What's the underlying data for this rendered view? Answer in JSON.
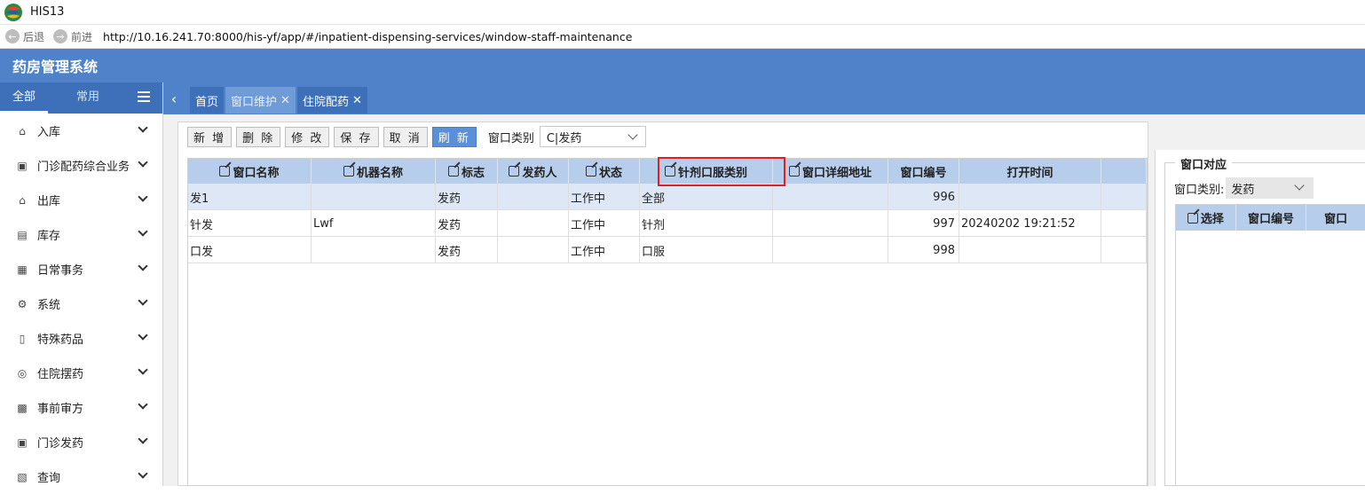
{
  "window": {
    "title": "HIS13"
  },
  "address_bar": {
    "back_label": "后退",
    "forward_label": "前进",
    "url": "http://10.16.241.70:8000/his-yf/app/#/inpatient-dispensing-services/window-staff-maintenance"
  },
  "app": {
    "title": "药房管理系统"
  },
  "sidebar": {
    "tabs": [
      "全部",
      "常用"
    ],
    "items": [
      {
        "label": "入库",
        "icon": "box-in-icon"
      },
      {
        "label": "门诊配药综合业务",
        "icon": "lock-icon"
      },
      {
        "label": "出库",
        "icon": "box-out-icon"
      },
      {
        "label": "库存",
        "icon": "inventory-icon"
      },
      {
        "label": "日常事务",
        "icon": "calendar-icon"
      },
      {
        "label": "系统",
        "icon": "gear-icon"
      },
      {
        "label": "特殊药品",
        "icon": "bottle-icon"
      },
      {
        "label": "住院摆药",
        "icon": "target-icon"
      },
      {
        "label": "事前审方",
        "icon": "briefcase-icon"
      },
      {
        "label": "门诊发药",
        "icon": "pill-icon"
      },
      {
        "label": "查询",
        "icon": "search-doc-icon"
      }
    ]
  },
  "tabs": [
    {
      "label": "首页",
      "closable": false,
      "active": false
    },
    {
      "label": "窗口维护",
      "closable": true,
      "active": true
    },
    {
      "label": "住院配药",
      "closable": true,
      "active": false
    }
  ],
  "toolbar": {
    "buttons": [
      "新 增",
      "删 除",
      "修 改",
      "保 存",
      "取 消",
      "刷 新"
    ],
    "window_type_label": "窗口类别",
    "window_type_value": "C|发药"
  },
  "grid": {
    "columns": [
      "窗口名称",
      "机器名称",
      "标志",
      "发药人",
      "状态",
      "针剂口服类别",
      "窗口详细地址",
      "窗口编号",
      "打开时间"
    ],
    "editable": [
      true,
      true,
      true,
      true,
      true,
      true,
      true,
      false,
      false
    ],
    "rows": [
      [
        "发1",
        "",
        "发药",
        "",
        "工作中",
        "全部",
        "",
        "996",
        ""
      ],
      [
        "针发",
        "Lwf",
        "发药",
        "",
        "工作中",
        "针剂",
        "",
        "997",
        "20240202 19:21:52"
      ],
      [
        "口发",
        "",
        "发药",
        "",
        "工作中",
        "口服",
        "",
        "998",
        ""
      ]
    ],
    "selected_row": 0,
    "highlighted_column": "针剂口服类别"
  },
  "right_panel": {
    "legend": "窗口对应",
    "filter_label": "窗口类别:",
    "filter_value": "发药",
    "columns": [
      "选择",
      "窗口编号",
      "窗口"
    ]
  },
  "colors": {
    "header_blue": "#4f82c8",
    "grid_header": "#b6cdeb",
    "highlight": "#e02020"
  }
}
